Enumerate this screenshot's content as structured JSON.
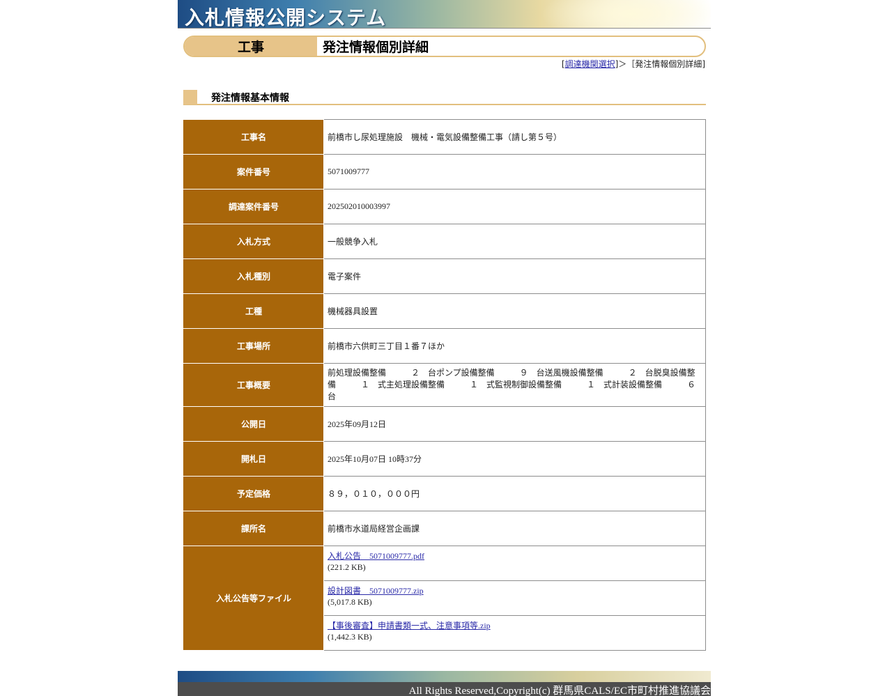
{
  "header": {
    "system_title": "入札情報公開システム"
  },
  "titlebar": {
    "category": "工事",
    "page_title": "発注情報個別詳細"
  },
  "breadcrumb": {
    "open": "[",
    "link": "調達機関選択",
    "sep": "]＞［",
    "current": "発注情報個別詳細",
    "close": "]"
  },
  "section": {
    "title": "発注情報基本情報"
  },
  "details": {
    "project_name": {
      "label": "工事名",
      "value": "前橋市し尿処理施設　機械・電気設備整備工事（請し第５号）"
    },
    "case_number": {
      "label": "案件番号",
      "value": "5071009777"
    },
    "procurement_number": {
      "label": "調達案件番号",
      "value": "202502010003997"
    },
    "bid_method": {
      "label": "入札方式",
      "value": "一般競争入札"
    },
    "bid_type": {
      "label": "入札種別",
      "value": "電子案件"
    },
    "work_type": {
      "label": "工種",
      "value": "機械器具設置"
    },
    "location": {
      "label": "工事場所",
      "value": "前橋市六供町三丁目１番７ほか"
    },
    "overview": {
      "label": "工事概要",
      "value": "前処理設備整備　　　２　台ポンプ設備整備　　　９　台送風機設備整備　　　２　台脱臭設備整備　　　１　式主処理設備整備　　　１　式監視制御設備整備　　　１　式計装設備整備　　　６　台"
    },
    "publish_date": {
      "label": "公開日",
      "value": "2025年09月12日"
    },
    "opening_date": {
      "label": "開札日",
      "value": "2025年10月07日 10時37分"
    },
    "planned_price": {
      "label": "予定価格",
      "value": "８９，０１０，０００円"
    },
    "department": {
      "label": "課所名",
      "value": "前橋市水道局経営企画課"
    },
    "files": {
      "label": "入札公告等ファイル",
      "items": [
        {
          "name": "入札公告　5071009777.pdf",
          "size": "(221.2 KB)"
        },
        {
          "name": "設計図書　5071009777.zip",
          "size": "(5,017.8 KB)"
        },
        {
          "name": "【事後審査】申請書類一式、注意事項等.zip",
          "size": "(1,442.3 KB)"
        }
      ]
    }
  },
  "footer": {
    "copyright": "All Rights Reserved,Copyright(c) 群馬県CALS/EC市町村推進協議会"
  }
}
